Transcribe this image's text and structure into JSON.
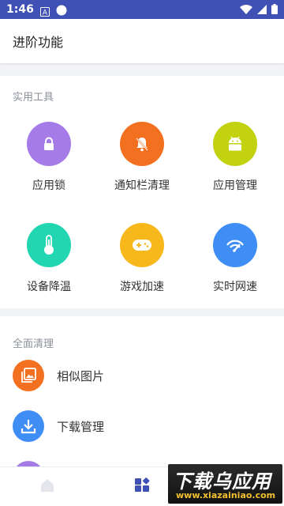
{
  "status_bar": {
    "time": "1:46",
    "icons": [
      "notification-a-icon",
      "circle-dot-icon",
      "wifi-icon",
      "signal-icon",
      "battery-icon"
    ]
  },
  "app_bar": {
    "title": "进阶功能"
  },
  "tools": {
    "title": "实用工具",
    "items": [
      {
        "label": "应用锁",
        "icon": "lock-icon",
        "color": "#a57be8"
      },
      {
        "label": "通知栏清理",
        "icon": "bell-off-icon",
        "color": "#f37021"
      },
      {
        "label": "应用管理",
        "icon": "android-icon",
        "color": "#c2d20f"
      },
      {
        "label": "设备降温",
        "icon": "thermometer-icon",
        "color": "#21d6b0"
      },
      {
        "label": "游戏加速",
        "icon": "gamepad-icon",
        "color": "#f7b81b"
      },
      {
        "label": "实时网速",
        "icon": "speed-icon",
        "color": "#3f8ef5"
      }
    ]
  },
  "clean": {
    "title": "全面清理",
    "items": [
      {
        "label": "相似图片",
        "icon": "photo-icon",
        "color": "#f37021"
      },
      {
        "label": "下载管理",
        "icon": "download-icon",
        "color": "#3f8ef5"
      },
      {
        "label": "",
        "icon": "partial-item-icon",
        "color": "#a57be8"
      }
    ]
  },
  "bottom_nav": {
    "items": [
      {
        "icon": "home-icon",
        "active": false
      },
      {
        "icon": "apps-icon",
        "active": true
      }
    ]
  },
  "watermark": {
    "main": "下载乌应用",
    "sub": "www.xiazainiao.com"
  }
}
